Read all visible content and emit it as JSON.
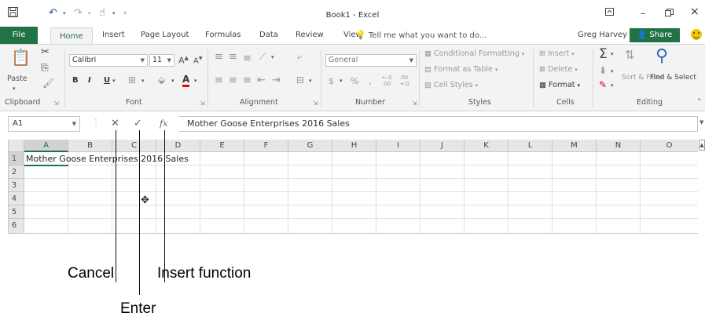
{
  "titlebar": {
    "title": "Book1 - Excel",
    "save_icon": "save-icon",
    "undo_icon": "undo-icon",
    "redo_icon": "redo-icon",
    "touch_icon": "touch-mode-icon",
    "customize_icon": "customize-qat-icon",
    "ribbon_display_icon": "ribbon-display-icon",
    "minimize_glyph": "–",
    "restore_glyph": "🗗",
    "close_glyph": "×"
  },
  "tabs": [
    "File",
    "Home",
    "Insert",
    "Page Layout",
    "Formulas",
    "Data",
    "Review",
    "View"
  ],
  "tell_me": "Tell me what you want to do...",
  "user": "Greg Harvey",
  "share": "Share",
  "ribbon": {
    "clipboard": {
      "label": "Clipboard",
      "paste": "Paste"
    },
    "font": {
      "label": "Font",
      "name": "Calibri",
      "size": "11",
      "bold": "B",
      "italic": "I",
      "underline": "U"
    },
    "alignment": {
      "label": "Alignment"
    },
    "number": {
      "label": "Number",
      "format": "General",
      "currency": "$",
      "percent": "%",
      "comma": ",",
      "inc_decimal": "←.0 .00",
      "dec_decimal": ".00 →.0"
    },
    "styles": {
      "label": "Styles",
      "conditional": "Conditional Formatting",
      "format_table": "Format as Table",
      "cell_styles": "Cell Styles"
    },
    "cells": {
      "label": "Cells",
      "insert": "Insert",
      "delete": "Delete",
      "format": "Format"
    },
    "editing": {
      "label": "Editing",
      "sort_filter": "Sort & Filter",
      "find_select": "Find & Select"
    }
  },
  "formula_bar": {
    "name_box": "A1",
    "cancel": "✕",
    "enter": "✓",
    "insert_fn": "fx",
    "content": "Mother Goose Enterprises 2016 Sales"
  },
  "grid": {
    "columns": [
      "A",
      "B",
      "C",
      "D",
      "E",
      "F",
      "G",
      "H",
      "I",
      "J",
      "K",
      "L",
      "M",
      "N",
      "O"
    ],
    "rows": [
      "1",
      "2",
      "3",
      "4",
      "5",
      "6"
    ],
    "a1": "Mother Goose Enterprises 2016 Sales"
  },
  "callouts": {
    "cancel": "Cancel",
    "insert_function": "Insert function",
    "enter": "Enter"
  },
  "colors": {
    "accent": "#217346",
    "ribbon_bg": "#f3f3f3",
    "header_bg": "#e6e6e6"
  }
}
